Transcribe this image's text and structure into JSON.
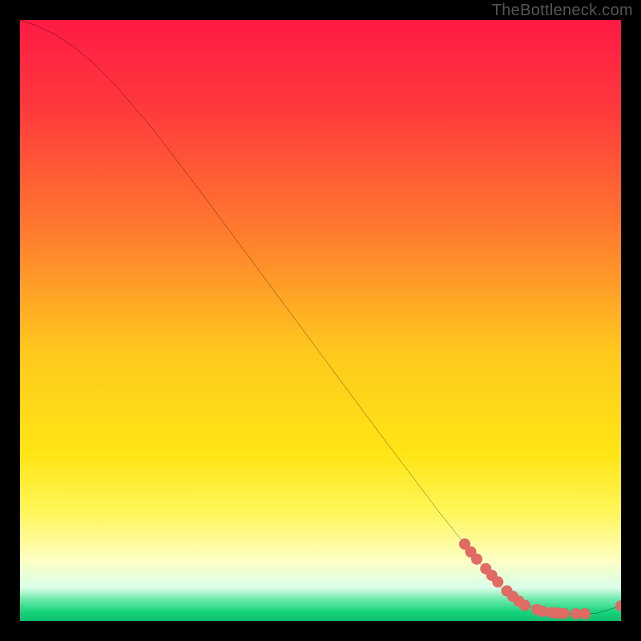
{
  "watermark": "TheBottleneck.com",
  "chart_data": {
    "type": "line",
    "title": "",
    "xlabel": "",
    "ylabel": "",
    "xlim": [
      0,
      100
    ],
    "ylim": [
      0,
      100
    ],
    "background_gradient": {
      "stops": [
        {
          "offset": 0.0,
          "color": "#ff1a44"
        },
        {
          "offset": 0.15,
          "color": "#ff3a3c"
        },
        {
          "offset": 0.35,
          "color": "#ff7a2e"
        },
        {
          "offset": 0.55,
          "color": "#ffc81e"
        },
        {
          "offset": 0.72,
          "color": "#ffe514"
        },
        {
          "offset": 0.82,
          "color": "#fff65a"
        },
        {
          "offset": 0.9,
          "color": "#fdffc5"
        },
        {
          "offset": 0.945,
          "color": "#d9ffe8"
        },
        {
          "offset": 0.965,
          "color": "#69e8a9"
        },
        {
          "offset": 0.985,
          "color": "#17d47c"
        },
        {
          "offset": 1.0,
          "color": "#0fbf6f"
        }
      ]
    },
    "series": [
      {
        "name": "bottleneck-curve",
        "x": [
          0,
          3,
          6,
          9,
          12,
          16,
          22,
          30,
          40,
          50,
          60,
          70,
          75,
          80,
          84,
          88,
          92,
          96,
          100
        ],
        "y": [
          100,
          99,
          97.5,
          95.5,
          93,
          89,
          82,
          71.5,
          58,
          44.5,
          31,
          17.8,
          11.5,
          5.5,
          2.6,
          1.4,
          1.2,
          1.3,
          2.5
        ]
      }
    ],
    "markers": {
      "name": "highlight-points",
      "color": "#e06a64",
      "radius": 7,
      "x": [
        74,
        75,
        76,
        77.5,
        78.5,
        79.5,
        81,
        82,
        83,
        84,
        86,
        87,
        88.5,
        89.5,
        90.5,
        92.5,
        94,
        100
      ],
      "y": [
        12.8,
        11.5,
        10.3,
        8.7,
        7.6,
        6.5,
        5.0,
        4.1,
        3.3,
        2.6,
        1.9,
        1.6,
        1.4,
        1.3,
        1.25,
        1.2,
        1.2,
        2.5
      ]
    }
  }
}
